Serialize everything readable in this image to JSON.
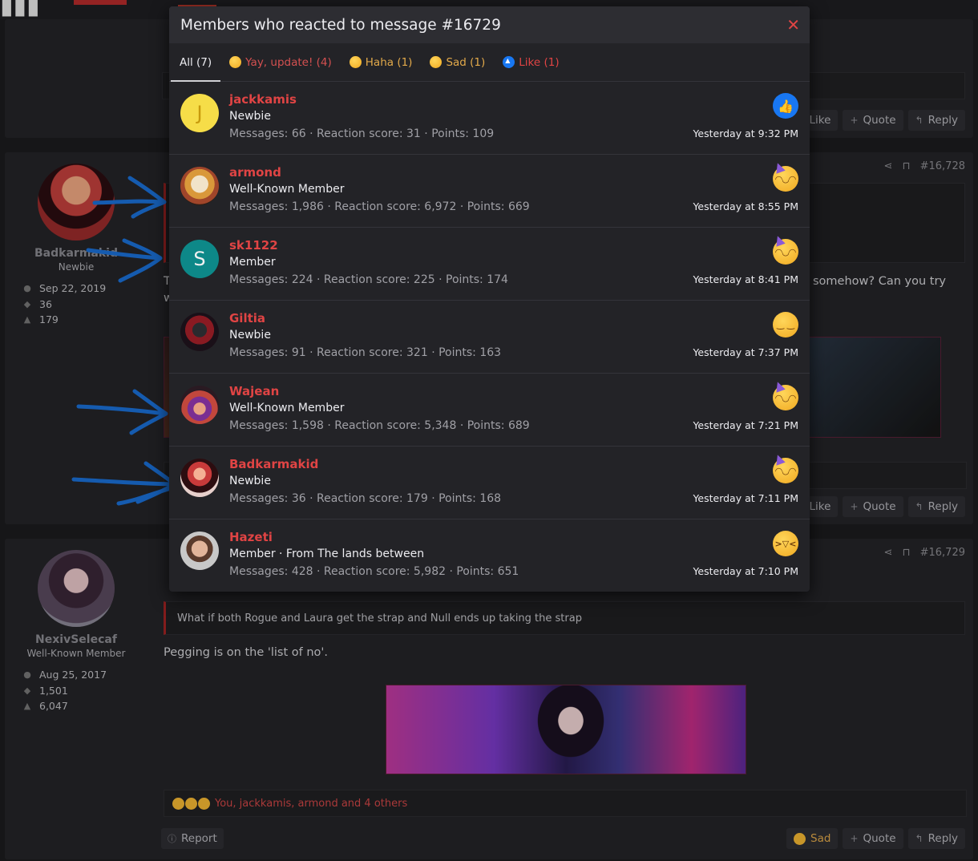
{
  "background": {
    "post1": {
      "actions": {
        "like": "Like",
        "quote": "Quote",
        "reply": "Reply"
      }
    },
    "post2": {
      "user": {
        "name": "Badkarmakid",
        "title": "Newbie",
        "joined": "Sep 22, 2019",
        "messages": "36",
        "reactions": "179"
      },
      "number": "#16,728",
      "text_partial_left": "Th",
      "text_partial_left2": "wi",
      "text_partial_right": "somehow? Can you try",
      "actions": {
        "like": "Like",
        "quote": "Quote",
        "reply": "Reply"
      }
    },
    "post3": {
      "user": {
        "name": "NexivSelecaf",
        "title": "Well-Known Member",
        "joined": "Aug 25, 2017",
        "messages": "1,501",
        "reactions": "6,047"
      },
      "number": "#16,729",
      "quote": "What if both Rogue and Laura get the strap and Null ends up taking the strap",
      "text": "Pegging is on the 'list of no'.",
      "reactions_summary": "You, jackkamis, armond and 4 others",
      "report": "Report",
      "actions": {
        "sad": "Sad",
        "quote": "Quote",
        "reply": "Reply"
      }
    }
  },
  "modal": {
    "title": "Members who reacted to message #16729",
    "close_icon": "close-icon",
    "tabs": [
      {
        "label": "All (7)",
        "icon": ""
      },
      {
        "label": "Yay, update! (4)",
        "icon": "yay-update-emoji"
      },
      {
        "label": "Haha (1)",
        "icon": "haha-emoji"
      },
      {
        "label": "Sad (1)",
        "icon": "sad-emoji"
      },
      {
        "label": "Like (1)",
        "icon": "like-icon"
      }
    ],
    "members": [
      {
        "name": "jackkamis",
        "title": "Newbie",
        "stats": "Messages: 66 · Reaction score: 31 · Points: 109",
        "time": "Yesterday at 9:32 PM",
        "reaction": "like",
        "avatar_letter": "J"
      },
      {
        "name": "armond",
        "title": "Well-Known Member",
        "stats": "Messages: 1,986 · Reaction score: 6,972 · Points: 669",
        "time": "Yesterday at 8:55 PM",
        "reaction": "yay-update"
      },
      {
        "name": "sk1122",
        "title": "Member",
        "stats": "Messages: 224 · Reaction score: 225 · Points: 174",
        "time": "Yesterday at 8:41 PM",
        "reaction": "yay-update",
        "avatar_letter": "S"
      },
      {
        "name": "Giltia",
        "title": "Newbie",
        "stats": "Messages: 91 · Reaction score: 321 · Points: 163",
        "time": "Yesterday at 7:37 PM",
        "reaction": "sad"
      },
      {
        "name": "Wajean",
        "title": "Well-Known Member",
        "stats": "Messages: 1,598 · Reaction score: 5,348 · Points: 689",
        "time": "Yesterday at 7:21 PM",
        "reaction": "yay-update"
      },
      {
        "name": "Badkarmakid",
        "title": "Newbie",
        "stats": "Messages: 36 · Reaction score: 179 · Points: 168",
        "time": "Yesterday at 7:11 PM",
        "reaction": "yay-update"
      },
      {
        "name": "Hazeti",
        "title": "Member · From The lands between",
        "stats": "Messages: 428 · Reaction score: 5,982 · Points: 651",
        "time": "Yesterday at 7:10 PM",
        "reaction": "haha"
      }
    ]
  },
  "colors": {
    "accent_red": "#e04444",
    "sad_gold": "#e2a94a",
    "like_blue": "#1877f2",
    "annotation_blue": "#1a6fd6"
  }
}
